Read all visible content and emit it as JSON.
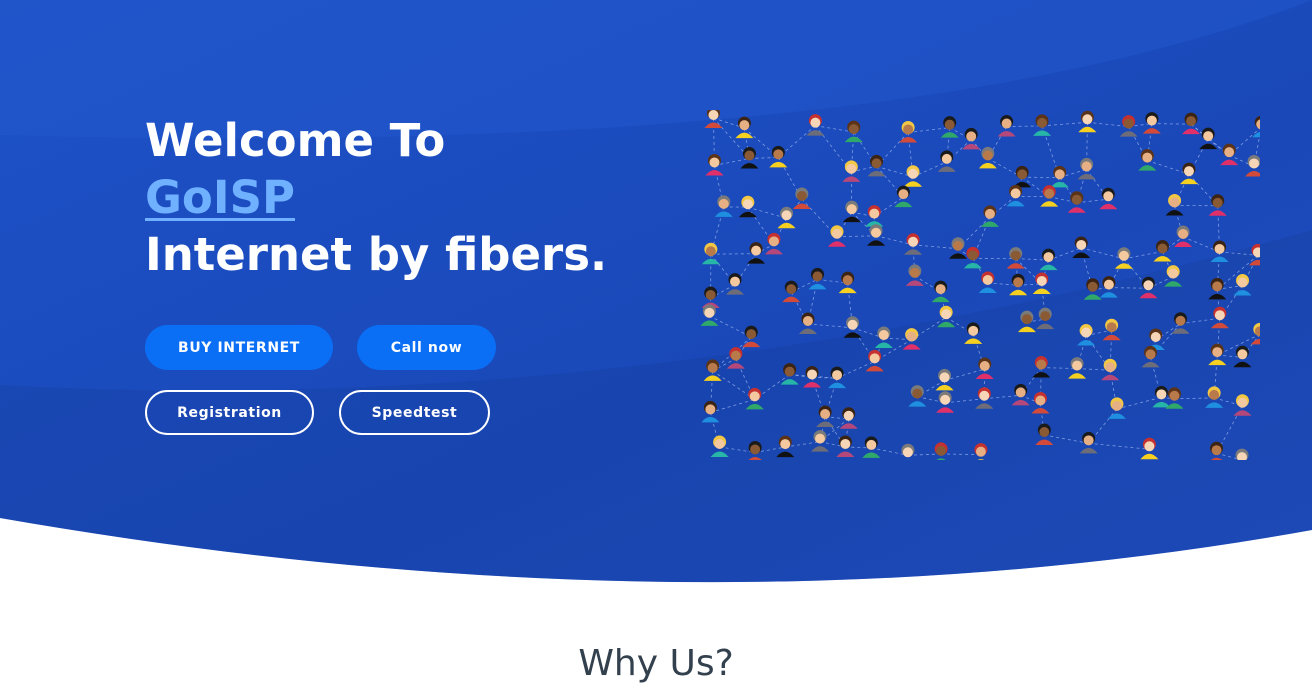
{
  "hero": {
    "title_line1": "Welcome To",
    "brand": "GoISP",
    "title_line3": "Internet by fibers.",
    "buttons": {
      "buy": "BUY INTERNET",
      "call": "Call now",
      "registration": "Registration",
      "speedtest": "Speedtest"
    },
    "colors": {
      "background": "#1a4fc4",
      "brand_link": "#6fb0ff",
      "solid_button": "#0a6ff5"
    },
    "illustration": "people-network-illustration"
  },
  "why_us": {
    "title": "Why Us?"
  }
}
